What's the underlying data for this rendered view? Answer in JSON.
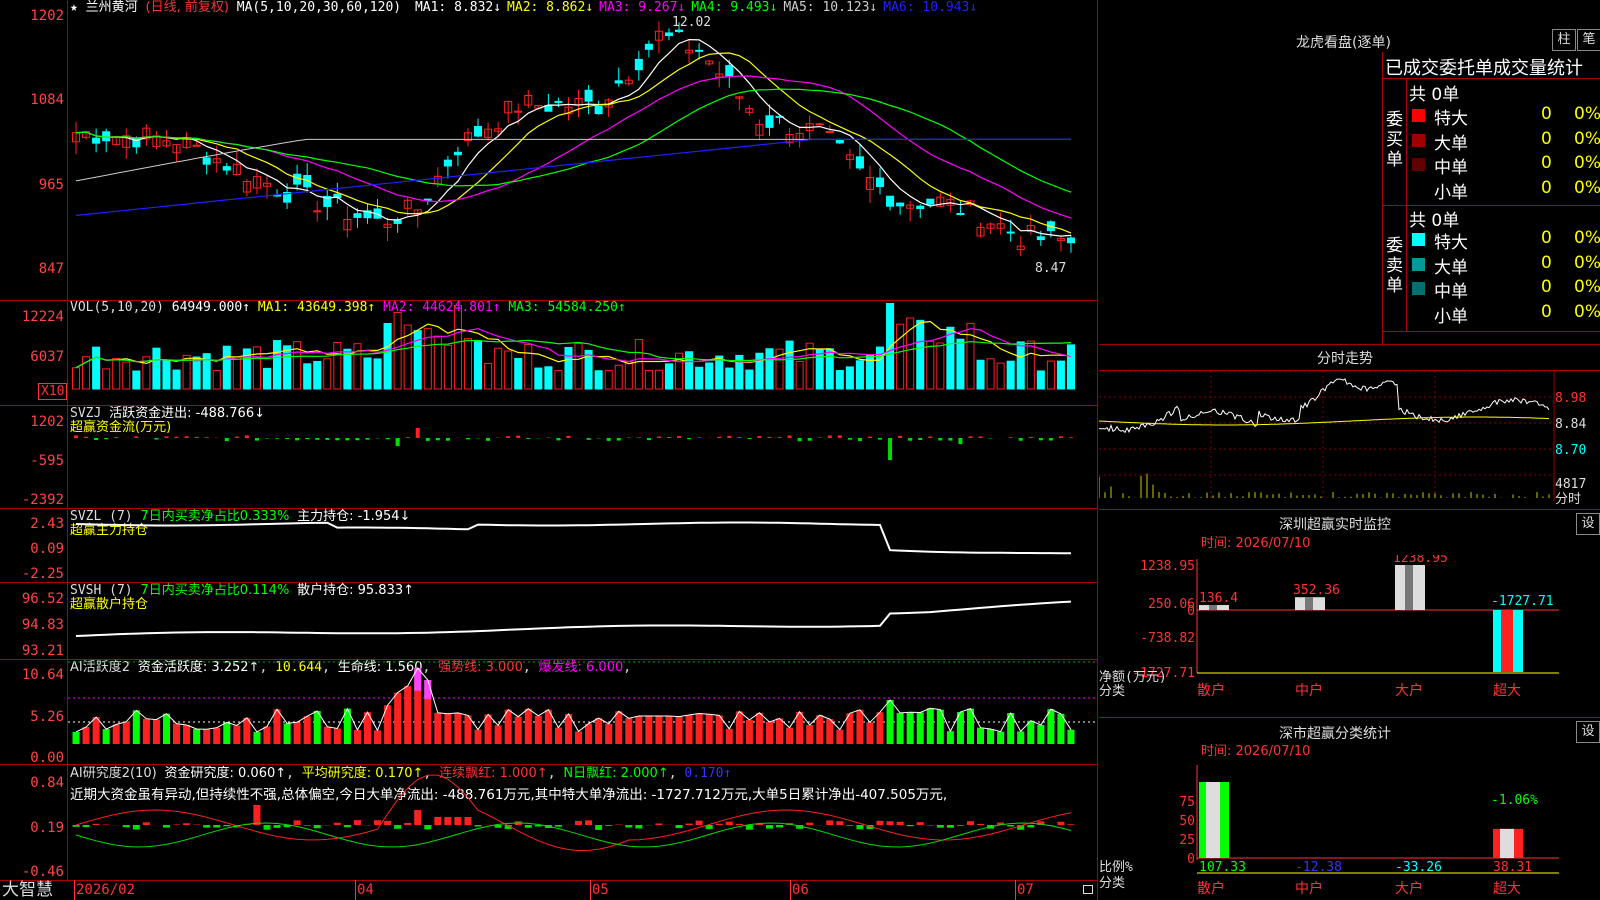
{
  "header": {
    "star": "★",
    "stock_name": "兰州黄河",
    "period": "(日线, 前复权)",
    "ma_params": "MA(5,10,20,30,60,120)",
    "ma": [
      {
        "label": "MA1:",
        "value": "8.832",
        "arrow": "↓",
        "color": "#ffffff"
      },
      {
        "label": "MA2:",
        "value": "8.862",
        "arrow": "↓",
        "color": "#ffff00"
      },
      {
        "label": "MA3:",
        "value": "9.267",
        "arrow": "↓",
        "color": "#ff00ff"
      },
      {
        "label": "MA4:",
        "value": "9.493",
        "arrow": "↓",
        "color": "#00ff00"
      },
      {
        "label": "MA5:",
        "value": "10.123",
        "arrow": "↓",
        "color": "#cccccc"
      },
      {
        "label": "MA6:",
        "value": "10.943",
        "arrow": "↓",
        "color": "#2020ff"
      }
    ],
    "high_label": "12.02",
    "low_label": "8.47"
  },
  "price_axis": [
    "1202",
    "1084",
    "965",
    "847"
  ],
  "vol": {
    "title": "VOL(5,10,20)",
    "value": "64949.000↑",
    "ma1": "MA1: 43649.398↑",
    "ma2": "MA2: 44624.801↑",
    "ma3": "MA3: 54584.250↑",
    "axis": [
      "12224",
      "6037"
    ],
    "unit": "X10"
  },
  "svzj": {
    "title": "SVZJ",
    "line1": "活跃资金进出: -488.766↓",
    "line2": "超赢资金流(万元)",
    "axis": [
      "1202",
      "-595",
      "-2392"
    ]
  },
  "svzl": {
    "title": "SVZL (7)",
    "line1": "7日内买卖净占比0.333%",
    "line1b": "主力持仓: -1.954↓",
    "line2": "超赢主力持仓",
    "axis": [
      "2.43",
      "0.09",
      "-2.25"
    ]
  },
  "svsh": {
    "title": "SVSH (7)",
    "line1": "7日内买卖净占比0.114%",
    "line1b": "散户持仓: 95.833↑",
    "line2": "超赢散户持仓",
    "axis": [
      "96.52",
      "94.83",
      "93.21"
    ]
  },
  "ai1": {
    "title": "AI活跃度2",
    "p1": "资金活跃度: 3.252↑",
    "p2": "10.644",
    "p3": "生命线: 1.560",
    "p4": "强势线: 3.000",
    "p5": "爆发线: 6.000",
    "axis": [
      "10.64",
      "5.26",
      "0.00"
    ]
  },
  "ai2": {
    "title": "AI研究度2(10)",
    "p1": "资金研究度: 0.060↑",
    "p2": "平均研究度: 0.170↑",
    "p3": "连续飘红: 1.000↑",
    "p4": "N日飘红: 2.000↑",
    "p5": "0.170↑",
    "note": "近期大资金虽有异动,但持续性不强,总体偏空,今日大单净流出: -488.761万元,其中特大单净流出: -1727.712万元,大单5日累计净出-407.505万元,",
    "axis": [
      "0.84",
      "0.19",
      "-0.46"
    ]
  },
  "bottom": {
    "brand": "大智慧",
    "dates": [
      "2026/02",
      "04",
      "05",
      "06",
      "07"
    ]
  },
  "right": {
    "dragon_title": "龙虎看盘(逐单)",
    "btn_bar": "柱",
    "btn_pen": "笔",
    "tabs_title": "已成交委托单成交量统计",
    "buy": {
      "side": "委买单",
      "total": "共 0单",
      "rows": [
        {
          "name": "特大",
          "count": "0",
          "pct": "0%",
          "color": "#ff0000"
        },
        {
          "name": "大单",
          "count": "0",
          "pct": "0%",
          "color": "#a00000"
        },
        {
          "name": "中单",
          "count": "0",
          "pct": "0%",
          "color": "#600000"
        },
        {
          "name": "小单",
          "count": "0",
          "pct": "0%",
          "color": "#000000"
        }
      ]
    },
    "sell": {
      "side": "委卖单",
      "total": "共 0单",
      "rows": [
        {
          "name": "特大",
          "count": "0",
          "pct": "0%",
          "color": "#00ffff"
        },
        {
          "name": "大单",
          "count": "0",
          "pct": "0%",
          "color": "#009999"
        },
        {
          "name": "中单",
          "count": "0",
          "pct": "0%",
          "color": "#007070"
        },
        {
          "name": "小单",
          "count": "0",
          "pct": "0%",
          "color": "#000000"
        }
      ]
    },
    "intraday": {
      "title": "分时走势",
      "axis": [
        "8.98",
        "8.84",
        "8.70"
      ],
      "vol_label": "4817",
      "vol_unit": "分时"
    },
    "monitor": {
      "title": "深圳超赢实时监控",
      "btn": "设",
      "time": "时间: 2026/07/10",
      "axis": [
        "1238.95",
        "250.06",
        "0",
        "-738.82",
        "-1727.71"
      ],
      "ylabel": "净额(万元)",
      "xlabel": "分类",
      "bar_labels": [
        "136.4",
        "352.36",
        "1238.95",
        "-1727.71"
      ],
      "categories": [
        "散户",
        "中户",
        "大户",
        "超大"
      ]
    },
    "classify": {
      "title": "深市超赢分类统计",
      "btn": "设",
      "time": "时间: 2026/07/10",
      "axis": [
        "75",
        "50",
        "25",
        "0"
      ],
      "ylabel": "比例%",
      "xlabel": "分类",
      "top_label": "-1.06%",
      "values": [
        "107.33",
        "-12.38",
        "-33.26",
        "38.31"
      ],
      "categories": [
        "散户",
        "中户",
        "大户",
        "超大"
      ]
    }
  },
  "colors": {
    "up": "#ff2020",
    "down": "#00ffff",
    "grid": "#aa0000"
  }
}
